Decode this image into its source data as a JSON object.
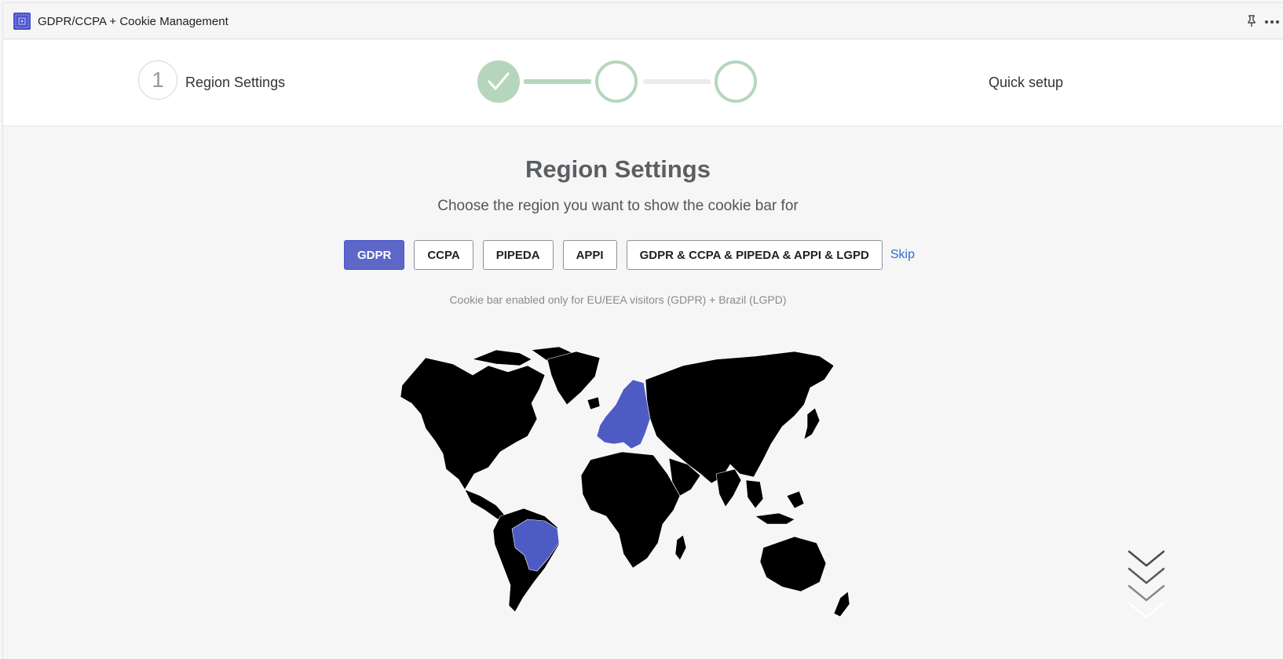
{
  "app": {
    "title": "GDPR/CCPA + Cookie Management",
    "icon": "app-grid-icon"
  },
  "titlebar_actions": {
    "pin_icon": "pin-icon",
    "more_icon": "more-horizontal-icon"
  },
  "stepper": {
    "current_step_number": "1",
    "current_step_label": "Region Settings",
    "steps_completed": 1,
    "total_steps": 3,
    "right_label": "Quick setup"
  },
  "main": {
    "title": "Region Settings",
    "subtitle": "Choose the region you want to show the cookie bar for",
    "region_options": [
      {
        "label": "GDPR",
        "selected": true
      },
      {
        "label": "CCPA",
        "selected": false
      },
      {
        "label": "PIPEDA",
        "selected": false
      },
      {
        "label": "APPI",
        "selected": false
      },
      {
        "label": "GDPR & CCPA & PIPEDA & APPI & LGPD",
        "selected": false
      }
    ],
    "skip_label": "Skip",
    "info_text": "Cookie bar enabled only for EU/EEA visitors (GDPR) + Brazil (LGPD)"
  },
  "colors": {
    "accent": "#5c67c7",
    "highlight_region": "#4f5bc4",
    "map_land": "#000000",
    "step_done": "#b5d6bd",
    "link": "#2c6ecb"
  }
}
